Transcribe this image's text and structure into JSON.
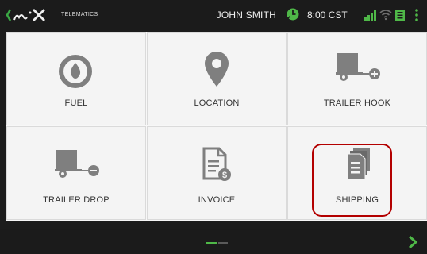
{
  "header": {
    "brand_tag": "TELEMATICS",
    "user_name": "JOHN SMITH",
    "time": "8:00 CST",
    "icons": [
      "clock-icon",
      "signal-icon",
      "wifi-icon",
      "document-status-icon",
      "menu-icon"
    ]
  },
  "tiles": [
    {
      "label": "FUEL",
      "icon": "fuel-drop-icon"
    },
    {
      "label": "LOCATION",
      "icon": "location-pin-icon"
    },
    {
      "label": "TRAILER HOOK",
      "icon": "trailer-hook-icon"
    },
    {
      "label": "TRAILER DROP",
      "icon": "trailer-drop-icon"
    },
    {
      "label": "INVOICE",
      "icon": "invoice-icon"
    },
    {
      "label": "SHIPPING",
      "icon": "shipping-documents-icon"
    }
  ],
  "footer": {
    "page_count": 2,
    "current_page": 1,
    "next_icon": "chevron-right-icon"
  },
  "colors": {
    "accent_green": "#4fb848",
    "highlight_red": "#b30000",
    "icon_gray": "#7f7f7f",
    "bar_black": "#1b1b1b"
  }
}
